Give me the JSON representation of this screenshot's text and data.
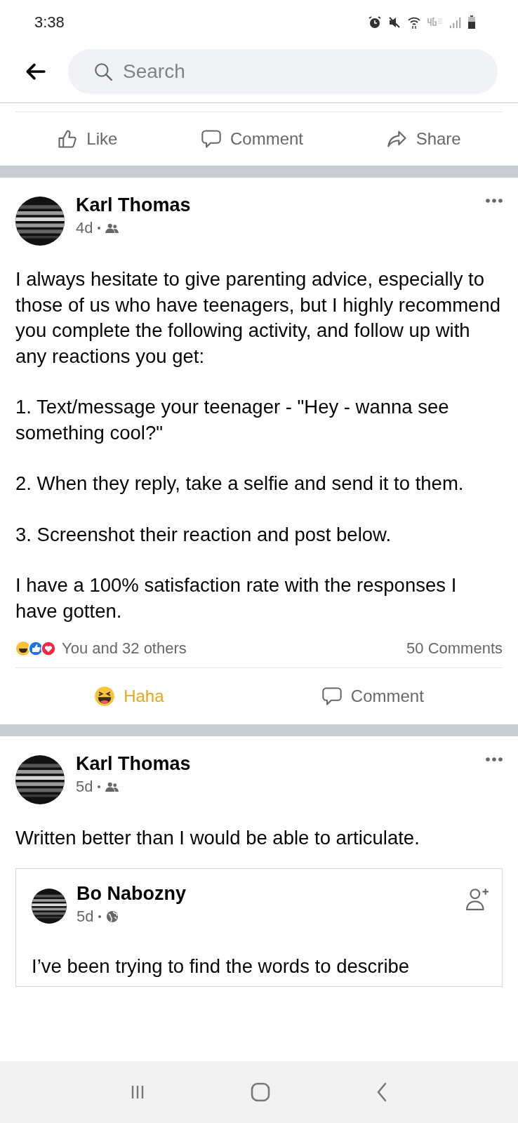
{
  "status_bar": {
    "time": "3:38"
  },
  "search": {
    "placeholder": "Search"
  },
  "previous_post_actions": [
    {
      "kind": "like",
      "label": "Like"
    },
    {
      "kind": "comment",
      "label": "Comment"
    },
    {
      "kind": "share",
      "label": "Share"
    }
  ],
  "posts": [
    {
      "author": "Karl Thomas",
      "time": "4d",
      "audience": {
        "kind": "friends"
      },
      "paragraphs": [
        "I always hesitate to give parenting advice, especially to those of us who have teenagers, but I highly recommend you complete the following activity, and follow up with any reactions you get:",
        "1.  Text/message your teenager - \"Hey - wanna see something cool?\"",
        "2.  When they reply, take a selfie and send it to them.",
        "3.  Screenshot their reaction and post below.",
        "I have a 100% satisfaction rate with the responses I have gotten."
      ],
      "reactions": {
        "summary": "You and 32 others",
        "comments": "50 Comments"
      },
      "actions": [
        {
          "kind": "haha",
          "label": "Haha",
          "selected": true
        },
        {
          "kind": "comment",
          "label": "Comment",
          "selected": false
        }
      ]
    },
    {
      "author": "Karl Thomas",
      "time": "5d",
      "audience": {
        "kind": "friends"
      },
      "paragraphs": [
        "Written better than I would be able to articulate."
      ],
      "shared": {
        "author": "Bo Nabozny",
        "time": "5d",
        "audience": {
          "kind": "public"
        },
        "paragraphs": [
          "I’ve been trying to find the words to describe"
        ]
      }
    }
  ]
}
